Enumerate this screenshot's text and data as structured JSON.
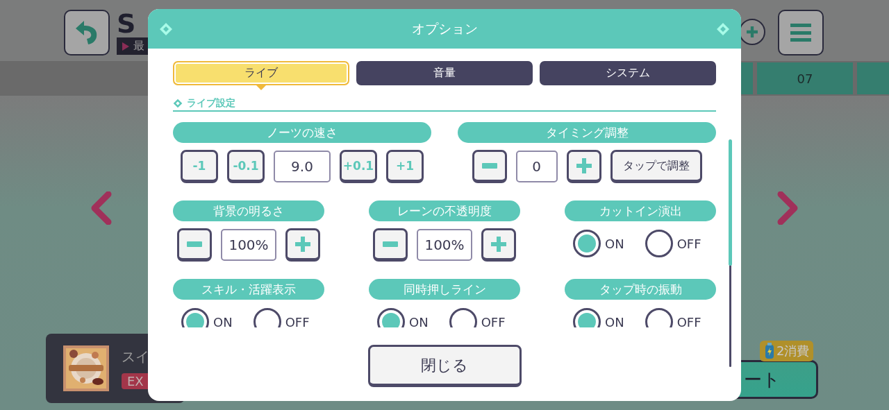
{
  "background": {
    "title": "S",
    "subtitle": "最",
    "band_cell": "07",
    "song": {
      "title": "スイ",
      "difficulty": "EX"
    },
    "start_button": {
      "label": "ート",
      "cost": "2消費"
    }
  },
  "dialog": {
    "title": "オプション",
    "tabs": [
      {
        "label": "ライブ",
        "selected": true
      },
      {
        "label": "音量",
        "selected": false
      },
      {
        "label": "システム",
        "selected": false
      }
    ],
    "section": "ライブ設定",
    "settings": [
      {
        "kind": "stepper",
        "label": "ノーツの速さ",
        "decrease": [
          "-1",
          "-0.1"
        ],
        "value": "9.0",
        "increase": [
          "+0.1",
          "+1"
        ]
      },
      {
        "kind": "stepper",
        "label": "タイミング調整",
        "value": "0",
        "action": "タップで調整"
      },
      {
        "kind": "stepper",
        "label": "背景の明るさ",
        "value": "100%"
      },
      {
        "kind": "stepper",
        "label": "レーンの不透明度",
        "value": "100%"
      },
      {
        "kind": "toggle",
        "label": "カットイン演出",
        "options": [
          {
            "label": "ON",
            "selected": true
          },
          {
            "label": "OFF",
            "selected": false
          }
        ]
      },
      {
        "kind": "toggle",
        "label": "スキル・活躍表示",
        "options": [
          {
            "label": "ON",
            "selected": true
          },
          {
            "label": "OFF",
            "selected": false
          }
        ]
      },
      {
        "kind": "toggle",
        "label": "同時押しライン",
        "options": [
          {
            "label": "ON",
            "selected": true
          },
          {
            "label": "OFF",
            "selected": false
          }
        ]
      },
      {
        "kind": "toggle",
        "label": "タップ時の振動",
        "options": [
          {
            "label": "ON",
            "selected": true
          },
          {
            "label": "OFF",
            "selected": false
          }
        ]
      }
    ],
    "close_button": "閉じる"
  }
}
